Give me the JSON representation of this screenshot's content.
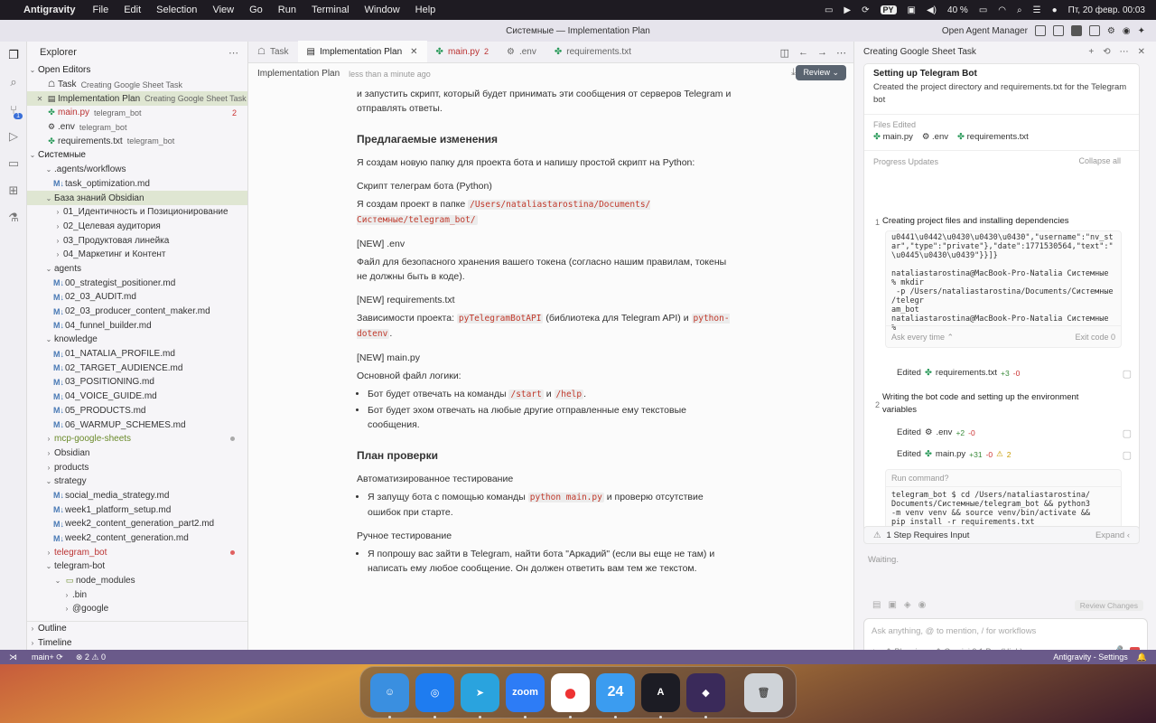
{
  "menubar": {
    "app": "Antigravity",
    "items": [
      "File",
      "Edit",
      "Selection",
      "View",
      "Go",
      "Run",
      "Terminal",
      "Window",
      "Help"
    ],
    "lang": "PY",
    "battery": "40 %",
    "datetime": "Пт, 20 февр.  00:03"
  },
  "window": {
    "title": "Системные — Implementation Plan",
    "open_agent_manager": "Open Agent Manager"
  },
  "explorer": {
    "title": "Explorer",
    "open_editors_label": "Open Editors",
    "open_editors": [
      {
        "name": "Task",
        "sub": "Creating Google Sheet Task",
        "icon": "bot-icon"
      },
      {
        "name": "Implementation Plan",
        "sub": "Creating Google Sheet Task",
        "icon": "doc-icon"
      },
      {
        "name": "main.py",
        "sub": "telegram_bot",
        "count": "2",
        "icon": "python-icon"
      },
      {
        "name": ".env",
        "sub": "telegram_bot",
        "icon": "gear-icon"
      },
      {
        "name": "requirements.txt",
        "sub": "telegram_bot",
        "icon": "python-icon"
      }
    ],
    "workspace_label": "Системные",
    "tree": [
      {
        "name": ".agents",
        "sep": "/",
        "name2": "workflows",
        "depth": 1,
        "open": true
      },
      {
        "name": "task_optimization.md",
        "depth": 2,
        "file": true
      },
      {
        "name": "База знаний Obsidian",
        "depth": 1,
        "open": true,
        "sel": true
      },
      {
        "name": "01_Идентичность и Позиционирование",
        "depth": 2
      },
      {
        "name": "02_Целевая аудитория",
        "depth": 2
      },
      {
        "name": "03_Продуктовая линейка",
        "depth": 2
      },
      {
        "name": "04_Маркетинг и Контент",
        "depth": 2
      },
      {
        "name": "agents",
        "depth": 1,
        "open": true
      },
      {
        "name": "00_strategist_positioner.md",
        "depth": 2,
        "file": true
      },
      {
        "name": "02_03_AUDIT.md",
        "depth": 2,
        "file": true
      },
      {
        "name": "02_03_producer_content_maker.md",
        "depth": 2,
        "file": true
      },
      {
        "name": "04_funnel_builder.md",
        "depth": 2,
        "file": true
      },
      {
        "name": "knowledge",
        "depth": 1,
        "open": true
      },
      {
        "name": "01_NATALIA_PROFILE.md",
        "depth": 2,
        "file": true
      },
      {
        "name": "02_TARGET_AUDIENCE.md",
        "depth": 2,
        "file": true
      },
      {
        "name": "03_POSITIONING.md",
        "depth": 2,
        "file": true
      },
      {
        "name": "04_VOICE_GUIDE.md",
        "depth": 2,
        "file": true
      },
      {
        "name": "05_PRODUCTS.md",
        "depth": 2,
        "file": true
      },
      {
        "name": "06_WARMUP_SCHEMES.md",
        "depth": 2,
        "file": true
      },
      {
        "name": "mcp-google-sheets",
        "depth": 1,
        "color": "green",
        "dot": "#aaa"
      },
      {
        "name": "Obsidian",
        "depth": 1
      },
      {
        "name": "products",
        "depth": 1
      },
      {
        "name": "strategy",
        "depth": 1,
        "open": true
      },
      {
        "name": "social_media_strategy.md",
        "depth": 2,
        "file": true
      },
      {
        "name": "week1_platform_setup.md",
        "depth": 2,
        "file": true
      },
      {
        "name": "week2_content_generation_part2.md",
        "depth": 2,
        "file": true
      },
      {
        "name": "week2_content_generation.md",
        "depth": 2,
        "file": true
      },
      {
        "name": "telegram_bot",
        "depth": 1,
        "color": "red",
        "dot": "#e06060"
      },
      {
        "name": "telegram-bot",
        "depth": 1,
        "open": true
      },
      {
        "name": "node_modules",
        "depth": 2,
        "open": true,
        "folder": true
      },
      {
        "name": ".bin",
        "depth": 3
      },
      {
        "name": "@google",
        "depth": 3
      }
    ],
    "outline": "Outline",
    "timeline": "Timeline"
  },
  "tabs": [
    {
      "label": "Task",
      "icon": "bot-icon"
    },
    {
      "label": "Implementation Plan",
      "icon": "doc-icon",
      "active": true
    },
    {
      "label": "main.py",
      "icon": "python-icon",
      "count": "2"
    },
    {
      "label": ".env",
      "icon": "gear-icon"
    },
    {
      "label": "requirements.txt",
      "icon": "python-icon"
    }
  ],
  "crumb": {
    "title": "Implementation Plan",
    "time": "less than a minute ago",
    "review": "Review"
  },
  "doc": {
    "intro": "и запустить скрипт, который будет принимать эти сообщения от серверов Telegram и отправлять ответы.",
    "h_changes": "Предлагаемые изменения",
    "p_changes": "Я создам новую папку для проекта бота и напишу простой скрипт на Python:",
    "h_script": "Скрипт телеграм бота (Python)",
    "p_script_a": "Я создам проект в папке ",
    "p_script_code": "/Users/nataliastarostina/Documents/Системные/telegram_bot/",
    "h_env": "[NEW] .env",
    "p_env": "Файл для безопасного хранения вашего токена (согласно нашим правилам, токены не должны быть в коде).",
    "h_req": "[NEW] requirements.txt",
    "p_req_a": "Зависимости проекта: ",
    "p_req_code1": "pyTelegramBotAPI",
    "p_req_b": " (библиотека для Telegram API) и ",
    "p_req_code2": "python-dotenv",
    "p_req_c": ".",
    "h_main": "[NEW] main.py",
    "p_main": "Основной файл логики:",
    "li1_a": "Бот будет отвечать на команды ",
    "li1_c1": "/start",
    "li1_b": " и ",
    "li1_c2": "/help",
    "li1_d": ".",
    "li2": "Бот будет эхом отвечать на любые другие отправленные ему текстовые сообщения.",
    "h_verify": "План проверки",
    "h_auto": "Автоматизированное тестирование",
    "li3_a": "Я запущу бота с помощью команды ",
    "li3_code": "python main.py",
    "li3_b": " и проверю отсутствие ошибок при старте.",
    "h_manual": "Ручное тестирование",
    "li4": "Я попрошу вас зайти в Telegram, найти бота \"Аркадий\" (если вы еще не там) и написать ему любое сообщение. Он должен ответить вам тем же текстом."
  },
  "agent": {
    "header": "Creating Google Sheet Task",
    "task_title": "Setting up Telegram Bot",
    "task_desc": "Created the project directory and requirements.txt for the Telegram bot",
    "files_edited_label": "Files Edited",
    "files": [
      {
        "name": "main.py",
        "icon": "python-icon"
      },
      {
        "name": ".env",
        "icon": "gear-icon"
      },
      {
        "name": "requirements.txt",
        "icon": "python-icon"
      }
    ],
    "progress_label": "Progress Updates",
    "collapse_all": "Collapse all",
    "step1_n": "1",
    "step1": "Creating project files and installing dependencies",
    "term_lines": [
      "u0441\\u0442\\u0430\\u0430\\u0430\",\"username\":\"nv_st",
      "ar\",\"type\":\"private\"},\"date\":1771530564,\"text\":\"",
      "\\u0445\\u0430\\u0439\"}}]}"
    ],
    "term2_lines": [
      "nataliastarostina@MacBook-Pro-Natalia Системные",
      "% mkdir",
      " -p /Users/nataliastarostina/Documents/Системные",
      "/telegr",
      "am_bot",
      "nataliastarostina@MacBook-Pro-Natalia Системные",
      "%"
    ],
    "ask_every_time": "Ask every time",
    "exit_code": "Exit code 0",
    "edited": "Edited",
    "ed1": {
      "file": "requirements.txt",
      "plus": "+3",
      "minus": "-0"
    },
    "step2_n": "2",
    "step2": "Writing the bot code and setting up the environment variables",
    "ed2": {
      "file": ".env",
      "plus": "+2",
      "minus": "-0"
    },
    "ed3": {
      "file": "main.py",
      "plus": "+31",
      "minus": "-0",
      "warn": "2"
    },
    "run_command": "Run command?",
    "cmd_lines": [
      "telegram_bot $ cd /Users/nataliastarostina/",
      "Documents/Системные/telegram_bot && python3",
      "-m venv venv && source venv/bin/activate &&",
      "pip install -r requirements.txt"
    ],
    "requires_input": "1 Step Requires Input",
    "expand": "Expand",
    "waiting": "Waiting.",
    "review_changes": "Review Changes",
    "placeholder": "Ask anything, @ to mention, / for workflows",
    "mode": "Planning",
    "model": "Gemini 3.1 Pro (High)"
  },
  "status": {
    "branch": "main+",
    "errors": "2",
    "warnings": "0",
    "right": "Antigravity - Settings"
  },
  "dock": [
    {
      "name": "Finder",
      "color": "#3a8fe0",
      "glyph": "☺"
    },
    {
      "name": "Safari",
      "color": "#1e7cf0",
      "glyph": "◎"
    },
    {
      "name": "Telegram",
      "color": "#2aa3de",
      "glyph": "➤"
    },
    {
      "name": "Zoom",
      "color": "#2d7cf6",
      "glyph": "zoom"
    },
    {
      "name": "Chrome",
      "color": "#ffffff",
      "glyph": "●"
    },
    {
      "name": "Calendar 24",
      "color": "#3b9cf0",
      "glyph": "24"
    },
    {
      "name": "Antigravity",
      "color": "#1c1c24",
      "glyph": "A"
    },
    {
      "name": "Obsidian",
      "color": "#3a2a5a",
      "glyph": "◆"
    },
    {
      "name": "Trash",
      "color": "#cfd3d8",
      "glyph": "🗑"
    }
  ]
}
